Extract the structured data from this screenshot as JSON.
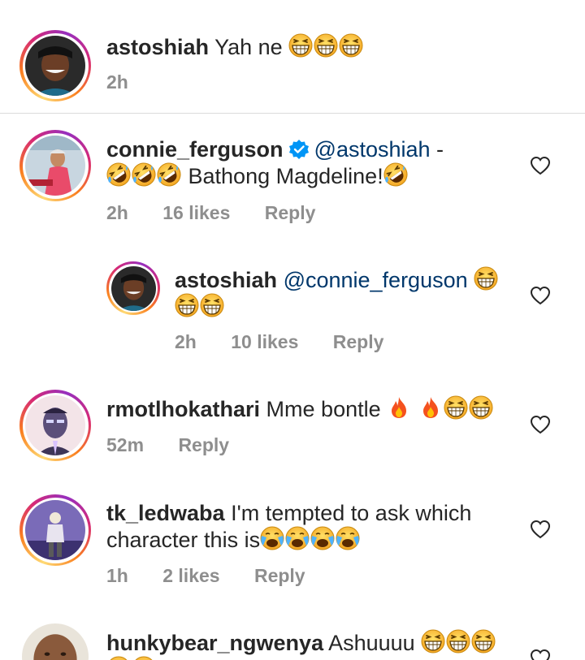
{
  "comments": [
    {
      "username": "astoshiah",
      "text": "Yah ne",
      "emojis": [
        "grin-squint-emoji",
        "grin-squint-emoji",
        "grin-squint-emoji"
      ],
      "time": "2h"
    },
    {
      "username": "connie_ferguson",
      "verified": true,
      "mention": "@astoshiah",
      "text_after_mention": " -",
      "line2_text": "Bathong Magdeline!",
      "line2_lead_emojis": [
        "rofl-emoji",
        "rofl-emoji",
        "rofl-emoji"
      ],
      "line2_trail_emojis": [
        "rofl-emoji"
      ],
      "time": "2h",
      "likes": "16 likes",
      "reply": "Reply"
    },
    {
      "username": "astoshiah",
      "mention": "@connie_ferguson",
      "time": "2h",
      "likes": "10 likes",
      "reply": "Reply"
    },
    {
      "username": "rmotlhokathari",
      "text": "Mme bontle",
      "time": "52m",
      "reply": "Reply"
    },
    {
      "username": "tk_ledwaba",
      "text": "I'm tempted to ask which",
      "line2_text": "character this is",
      "time": "1h",
      "likes": "2 likes",
      "reply": "Reply"
    },
    {
      "username": "hunkybear_ngwenya",
      "text": "Ashuuuu"
    }
  ],
  "colors": {
    "username": "#262626",
    "mention": "#00376b",
    "meta": "#8e8e8e",
    "verified": "#0095f6",
    "ring_start": "#feda75",
    "ring_end": "#962fbf"
  },
  "icons": {
    "like": "heart-outline-icon",
    "verified": "verified-badge-icon"
  }
}
